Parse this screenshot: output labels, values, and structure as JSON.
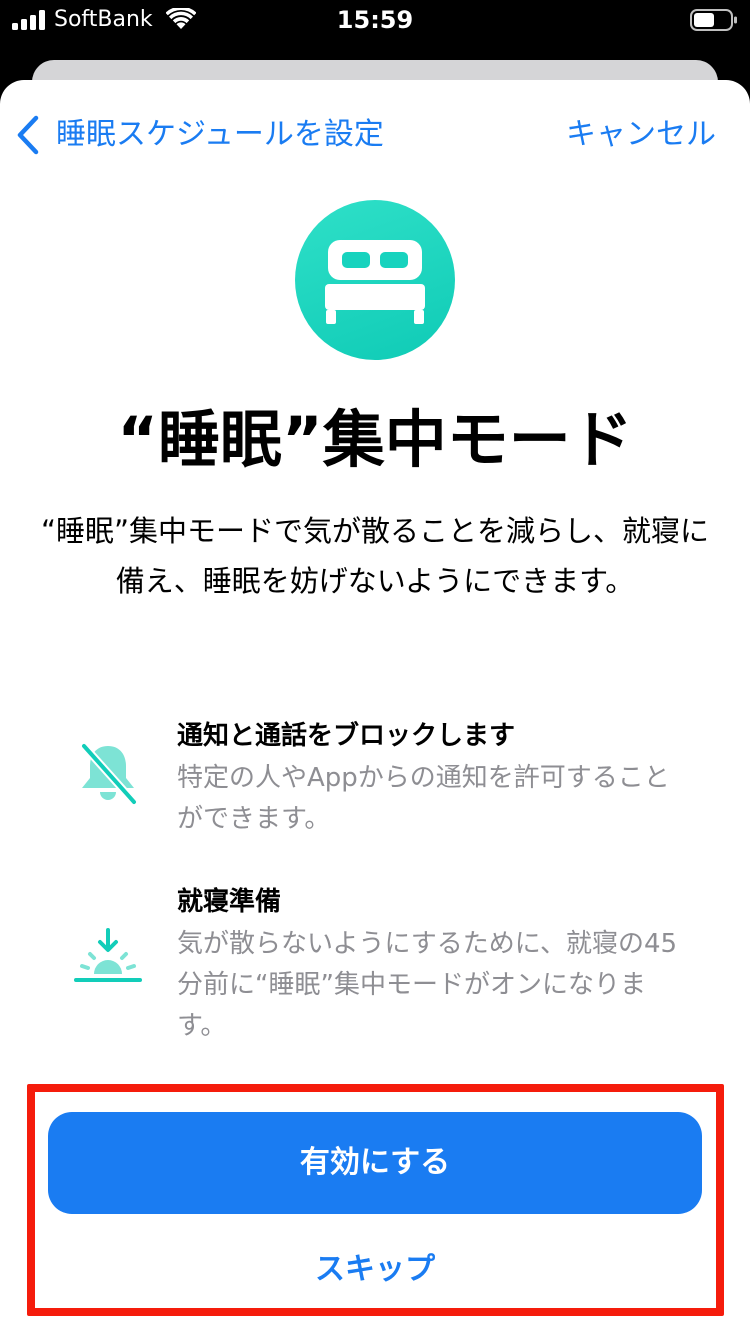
{
  "status_bar": {
    "carrier": "SoftBank",
    "time": "15:59",
    "icons": [
      "signal-icon",
      "wifi-icon",
      "battery-icon"
    ]
  },
  "nav": {
    "back_label": "睡眠スケジュールを設定",
    "cancel_label": "キャンセル"
  },
  "hero": {
    "icon": "bed-icon",
    "title": "“睡眠”集中モード",
    "description": "“睡眠”集中モードで気が散ることを減らし、就寝に備え、睡眠を妨げないようにできます。"
  },
  "features": [
    {
      "icon": "bell-slash-icon",
      "title": "通知と通話をブロックします",
      "body": "特定の人やAppからの通知を許可することができます。"
    },
    {
      "icon": "sunset-icon",
      "title": "就寝準備",
      "body": "気が散らないようにするために、就寝の45分前に“睡眠”集中モードがオンになります。"
    }
  ],
  "actions": {
    "primary_label": "有効にする",
    "secondary_label": "スキップ"
  },
  "colors": {
    "accent": "#1a7cf2",
    "teal": "#12cdb9",
    "highlight": "#f51c0c",
    "secondary_text": "#8e8e93"
  }
}
